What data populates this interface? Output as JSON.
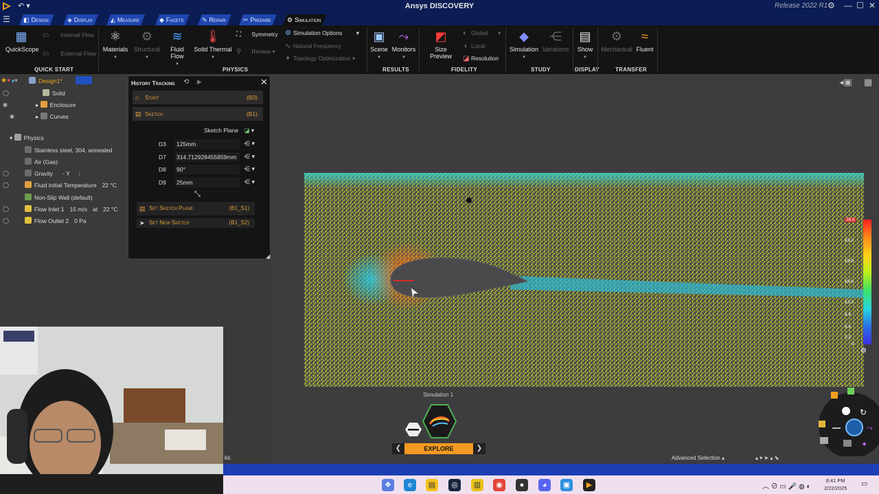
{
  "window": {
    "title": "Ansys DISCOVERY",
    "release": "Release 2022 R1"
  },
  "tabs": [
    {
      "label": "Design",
      "icon": "design-icon"
    },
    {
      "label": "Display",
      "icon": "display-icon"
    },
    {
      "label": "Measure",
      "icon": "measure-icon"
    },
    {
      "label": "Facets",
      "icon": "facets-icon"
    },
    {
      "label": "Repair",
      "icon": "repair-icon"
    },
    {
      "label": "Prepare",
      "icon": "prepare-icon"
    },
    {
      "label": "Simulation",
      "icon": "simulation-icon",
      "active": true
    }
  ],
  "ribbon": {
    "quickstart": {
      "quickscope": "QuickScope",
      "internal_flow": "Internal Flow",
      "external_flow": "External Flow",
      "group": "QUICK START"
    },
    "physics": {
      "materials": "Materials",
      "structural": "Structural",
      "fluid_flow": "Fluid Flow",
      "solid_thermal": "Solid Thermal",
      "symmetry": "Symmetry",
      "review": "Review",
      "group": "PHYSICS"
    },
    "options": {
      "simulation_options": "Simulation Options",
      "natural_frequency": "Natural Frequency",
      "topology_optimization": "Topology Optimization"
    },
    "results": {
      "scene": "Scene",
      "monitors": "Monitors",
      "group": "RESULTS"
    },
    "fidelity": {
      "size_preview": "Size Preview",
      "global": "Global",
      "local": "Local",
      "resolution": "Resolution",
      "group": "FIDELITY"
    },
    "study": {
      "simulation": "Simulation",
      "variations": "Variations",
      "group": "STUDY"
    },
    "display": {
      "show": "Show",
      "group": "DISPLAY"
    },
    "transfer": {
      "mechanical": "Mechanical",
      "fluent": "Fluent",
      "group": "TRANSFER"
    }
  },
  "tree": {
    "root": "Design1*",
    "items": [
      {
        "label": "Solid"
      },
      {
        "label": "Enclosure"
      },
      {
        "label": "Curves"
      }
    ],
    "physics": "Physics",
    "physics_items": [
      {
        "label": "Stainless steel, 304, annealed",
        "value": ""
      },
      {
        "label": "Air (Gas)",
        "value": ""
      },
      {
        "label": "Gravity",
        "value": "- Y"
      },
      {
        "label": "Fluid Initial Temperature",
        "value": "22 °C"
      },
      {
        "label": "Non-Slip Wall (default)",
        "value": ""
      },
      {
        "label": "Flow Inlet 1",
        "value": "15 m/s",
        "value2_prefix": "at",
        "value2": "22 °C"
      },
      {
        "label": "Flow Outlet 2",
        "value": "0 Pa"
      }
    ]
  },
  "history": {
    "title": "History Tracking",
    "steps": [
      {
        "label": "Start",
        "code": "(B0)"
      },
      {
        "label": "Sketch",
        "code": "(B1)"
      }
    ],
    "sketch_plane": "Sketch Plane",
    "dimensions": [
      {
        "name": "D3",
        "value": "125mm"
      },
      {
        "name": "D7",
        "value": "314.712928455859mm"
      },
      {
        "name": "D8",
        "value": "90°"
      },
      {
        "name": "D9",
        "value": "25mm"
      }
    ],
    "substeps": [
      {
        "label": "Set Sketch Plane",
        "code": "(B1_S1)"
      },
      {
        "label": "Set New Sketch",
        "code": "(B1_S2)"
      }
    ]
  },
  "viewport": {
    "simulation_label": "Simulation 1",
    "explore": "EXPLORE",
    "advanced_selection": "Advanced Selection",
    "status_left": "lid.",
    "colorbar": {
      "max": "26.5",
      "ticks": [
        "23.2",
        "19.9",
        "16.6",
        "13.3",
        "9.9",
        "6.6",
        "3.3"
      ],
      "min": "0",
      "colors": [
        "#ff1f1f",
        "#ff8a1a",
        "#ffd21a",
        "#b7f01c",
        "#3de06a",
        "#26d7e0",
        "#2c6fe8",
        "#3c2fe0"
      ]
    }
  },
  "taskbar": {
    "time": "8:41 PM",
    "date": "2/22/2025"
  },
  "colors": {
    "brand": "#0b1d54",
    "tab": "#1f46b0",
    "accent": "#f29a22",
    "statusbar": "#1c3fb4"
  }
}
